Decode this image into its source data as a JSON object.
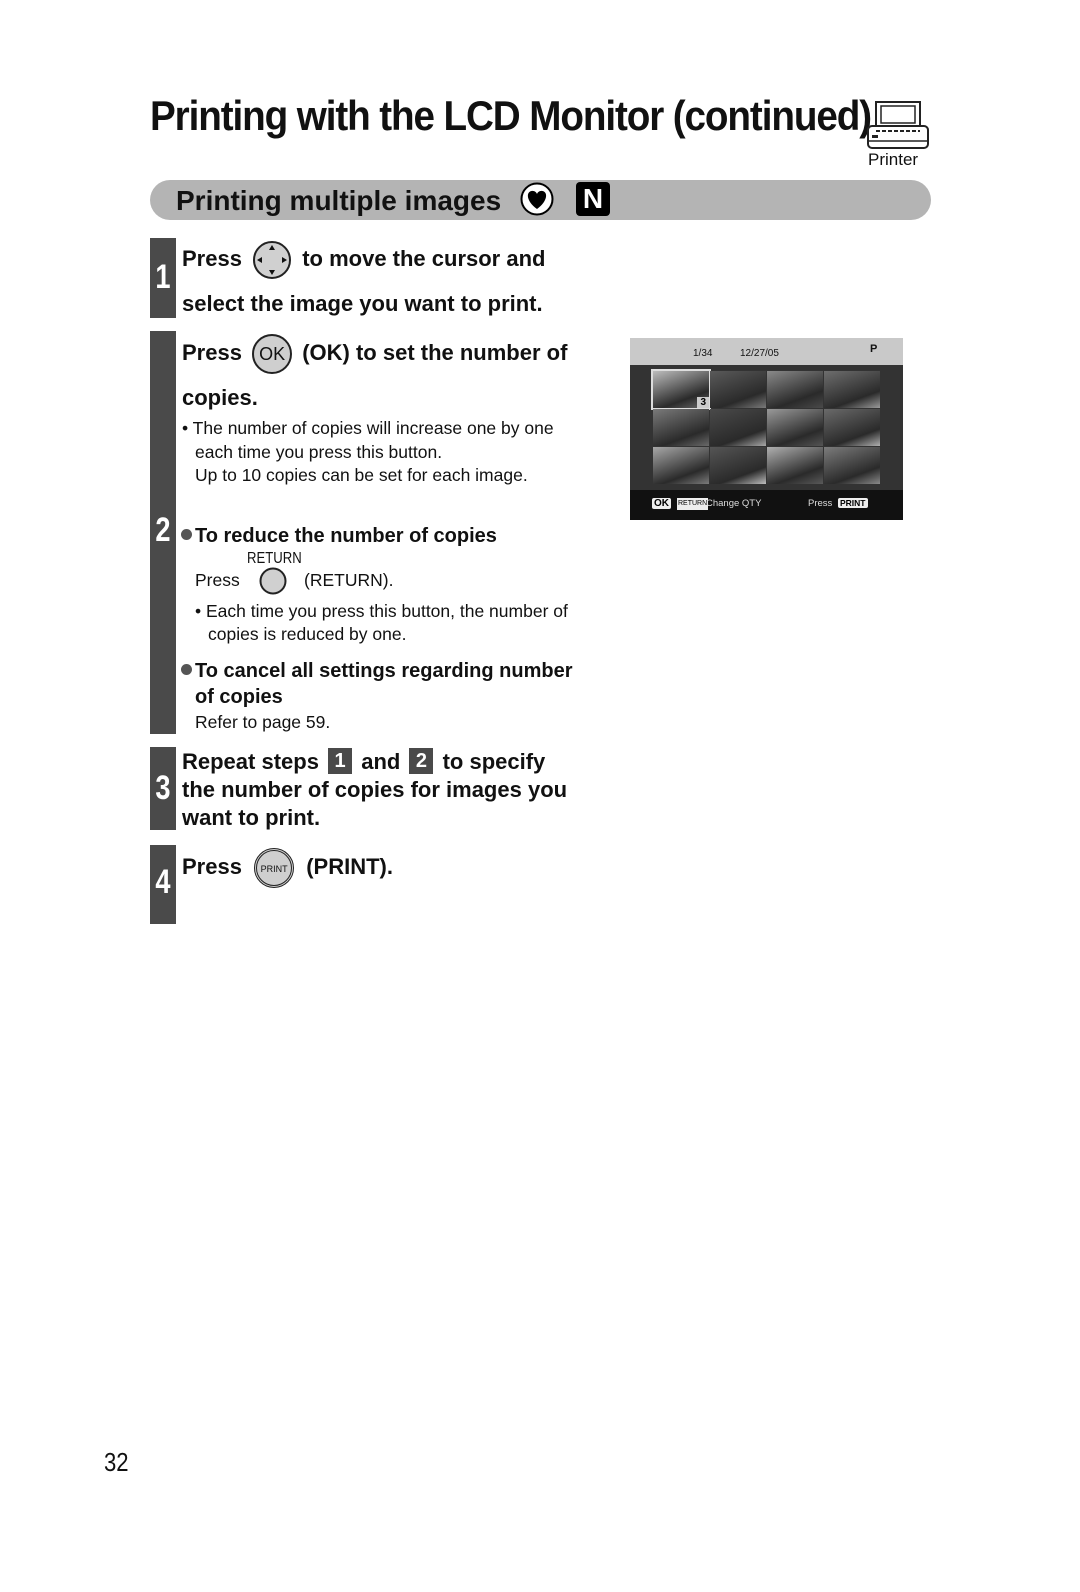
{
  "header": {
    "title": "Printing with the LCD Monitor (continued)",
    "device_icon": "printer-icon",
    "device_label": "Printer"
  },
  "section": {
    "title": "Printing multiple images",
    "mode_icons": [
      "heart-mode-icon",
      "n-mode-icon"
    ],
    "n_label": "N"
  },
  "steps": [
    {
      "number": "1",
      "line1_pre": "Press",
      "line1_icon": "dpad-icon",
      "line1_post": "to move the cursor and",
      "line2": "select the image you want to print."
    },
    {
      "number": "2",
      "line1_pre": "Press",
      "line1_icon": "ok-button-icon",
      "ok_label": "OK",
      "line1_post": "(OK) to set the number of",
      "line2": "copies.",
      "notes": [
        "• The number of copies will increase one by one",
        "each time you press this button.",
        "Up to 10 copies can be set for each image."
      ],
      "reduce": {
        "heading": "To reduce the number of copies",
        "button_caption": "RETURN",
        "press_pre": "Press",
        "press_post": "(RETURN).",
        "notes": [
          "• Each time you press this button, the number of",
          "copies is reduced by one."
        ]
      },
      "cancel": {
        "heading_line1": "To cancel all settings regarding number",
        "heading_line2": "of copies",
        "ref": "Refer to page 59."
      }
    },
    {
      "number": "3",
      "line1_pre": "Repeat steps",
      "ref1": "1",
      "line1_mid": "and",
      "ref2": "2",
      "line1_post": "to specify",
      "line2": "the number of copies for images you",
      "line3": "want to print."
    },
    {
      "number": "4",
      "line1_pre": "Press",
      "print_label": "PRINT",
      "line1_post": "(PRINT)."
    }
  ],
  "lcd_screen": {
    "counter": "1/34",
    "date": "12/27/05",
    "mode_indicator": "P",
    "selected_copies": "3",
    "thumbnail_count": 12,
    "footer_ok": "OK",
    "footer_return": "RETURN",
    "footer_change": "Change QTY",
    "footer_press": "Press",
    "footer_print": "PRINT"
  },
  "page_number": "32"
}
